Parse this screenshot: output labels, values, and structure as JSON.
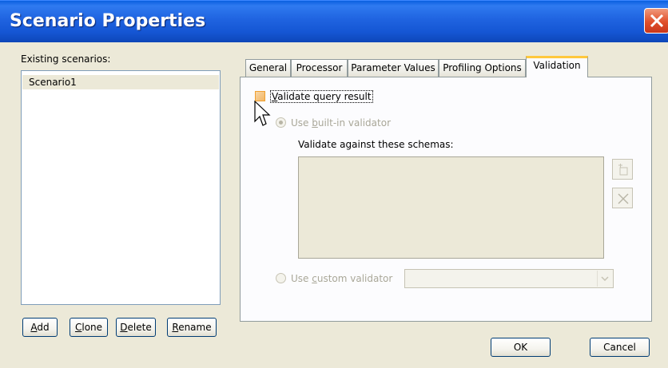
{
  "window": {
    "title": "Scenario Properties"
  },
  "sidebar": {
    "label": "Existing scenarios:",
    "scenarios": [
      "Scenario1"
    ],
    "buttons": {
      "add": {
        "key": "A",
        "rest": "dd"
      },
      "clone": {
        "key": "C",
        "rest": "lone"
      },
      "delete": {
        "key": "D",
        "rest": "elete"
      },
      "rename": {
        "key": "R",
        "rest": "ename"
      }
    }
  },
  "tabs": [
    {
      "label": "General"
    },
    {
      "label": "Processor"
    },
    {
      "label": "Parameter Values"
    },
    {
      "label": "Profiling Options"
    },
    {
      "label": "Validation"
    }
  ],
  "validation": {
    "validate_query": {
      "key": "V",
      "rest": "alidate query result"
    },
    "builtin": {
      "pre": "Use ",
      "key": "b",
      "rest": "uilt-in validator"
    },
    "schemas_label": "Validate against these schemas:",
    "custom": {
      "pre": "Use ",
      "key": "c",
      "rest": "ustom validator"
    },
    "custom_value": ""
  },
  "footer": {
    "ok": "OK",
    "cancel": "Cancel"
  },
  "colors": {
    "titlebar": "#1556d4",
    "active_tab_accent": "#ffc83c",
    "checkbox_hover": "#f0a030",
    "disabled_text": "#a9a798"
  }
}
